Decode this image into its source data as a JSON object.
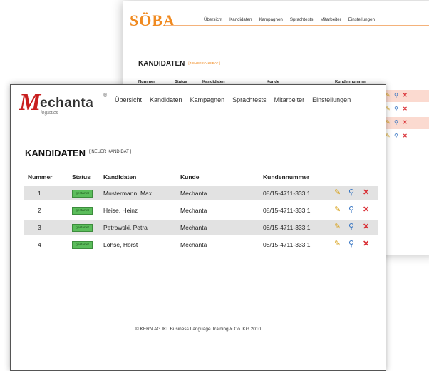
{
  "background_window": {
    "logo": "SÖBA",
    "nav": [
      "Übersicht",
      "Kandidaten",
      "Kampagnen",
      "Sprachtests",
      "Mitarbeiter",
      "Einstellungen"
    ],
    "title": "KANDIDATEN",
    "new_badge": "[ NEUER KANDIDAT ]",
    "headers": [
      "Nummer",
      "Status",
      "Kandidaten",
      "Kunde",
      "Kundennummer"
    ]
  },
  "app": {
    "logo_initial": "M",
    "logo_rest": "echanta",
    "logo_registered": "®",
    "logo_sub": "logistics",
    "nav": [
      "Übersicht",
      "Kandidaten",
      "Kampagnen",
      "Sprachtests",
      "Mitarbeiter",
      "Einstellungen"
    ]
  },
  "main": {
    "title": "KANDIDATEN",
    "new_candidate": "[ NEUER KANDIDAT ]",
    "columns": [
      "Nummer",
      "Status",
      "Kandidaten",
      "Kunde",
      "Kundennummer"
    ],
    "rows": [
      {
        "nummer": "1",
        "status": "gestartet",
        "kandidat": "Mustermann, Max",
        "kunde": "Mechanta",
        "kundennummer": "08/15-4711-333 1"
      },
      {
        "nummer": "2",
        "status": "gestartet",
        "kandidat": "Heise, Heinz",
        "kunde": "Mechanta",
        "kundennummer": "08/15-4711-333 1"
      },
      {
        "nummer": "3",
        "status": "gestartet",
        "kandidat": "Petrowski, Petra",
        "kunde": "Mechanta",
        "kundennummer": "08/15-4711-333 1"
      },
      {
        "nummer": "4",
        "status": "gestartet",
        "kandidat": "Lohse, Horst",
        "kunde": "Mechanta",
        "kundennummer": "08/15-4711-333 1"
      }
    ]
  },
  "icons": {
    "edit": "pencil-icon",
    "view": "magnifier-icon",
    "delete": "close-icon"
  },
  "footer": "© KERN AG IKL Business Language Training & Co. KG 2010",
  "colors": {
    "brand_red": "#c81e1e",
    "soba_orange": "#f08a20",
    "status_green": "#5bbd5b",
    "row_shade": "#e2e2e2"
  }
}
